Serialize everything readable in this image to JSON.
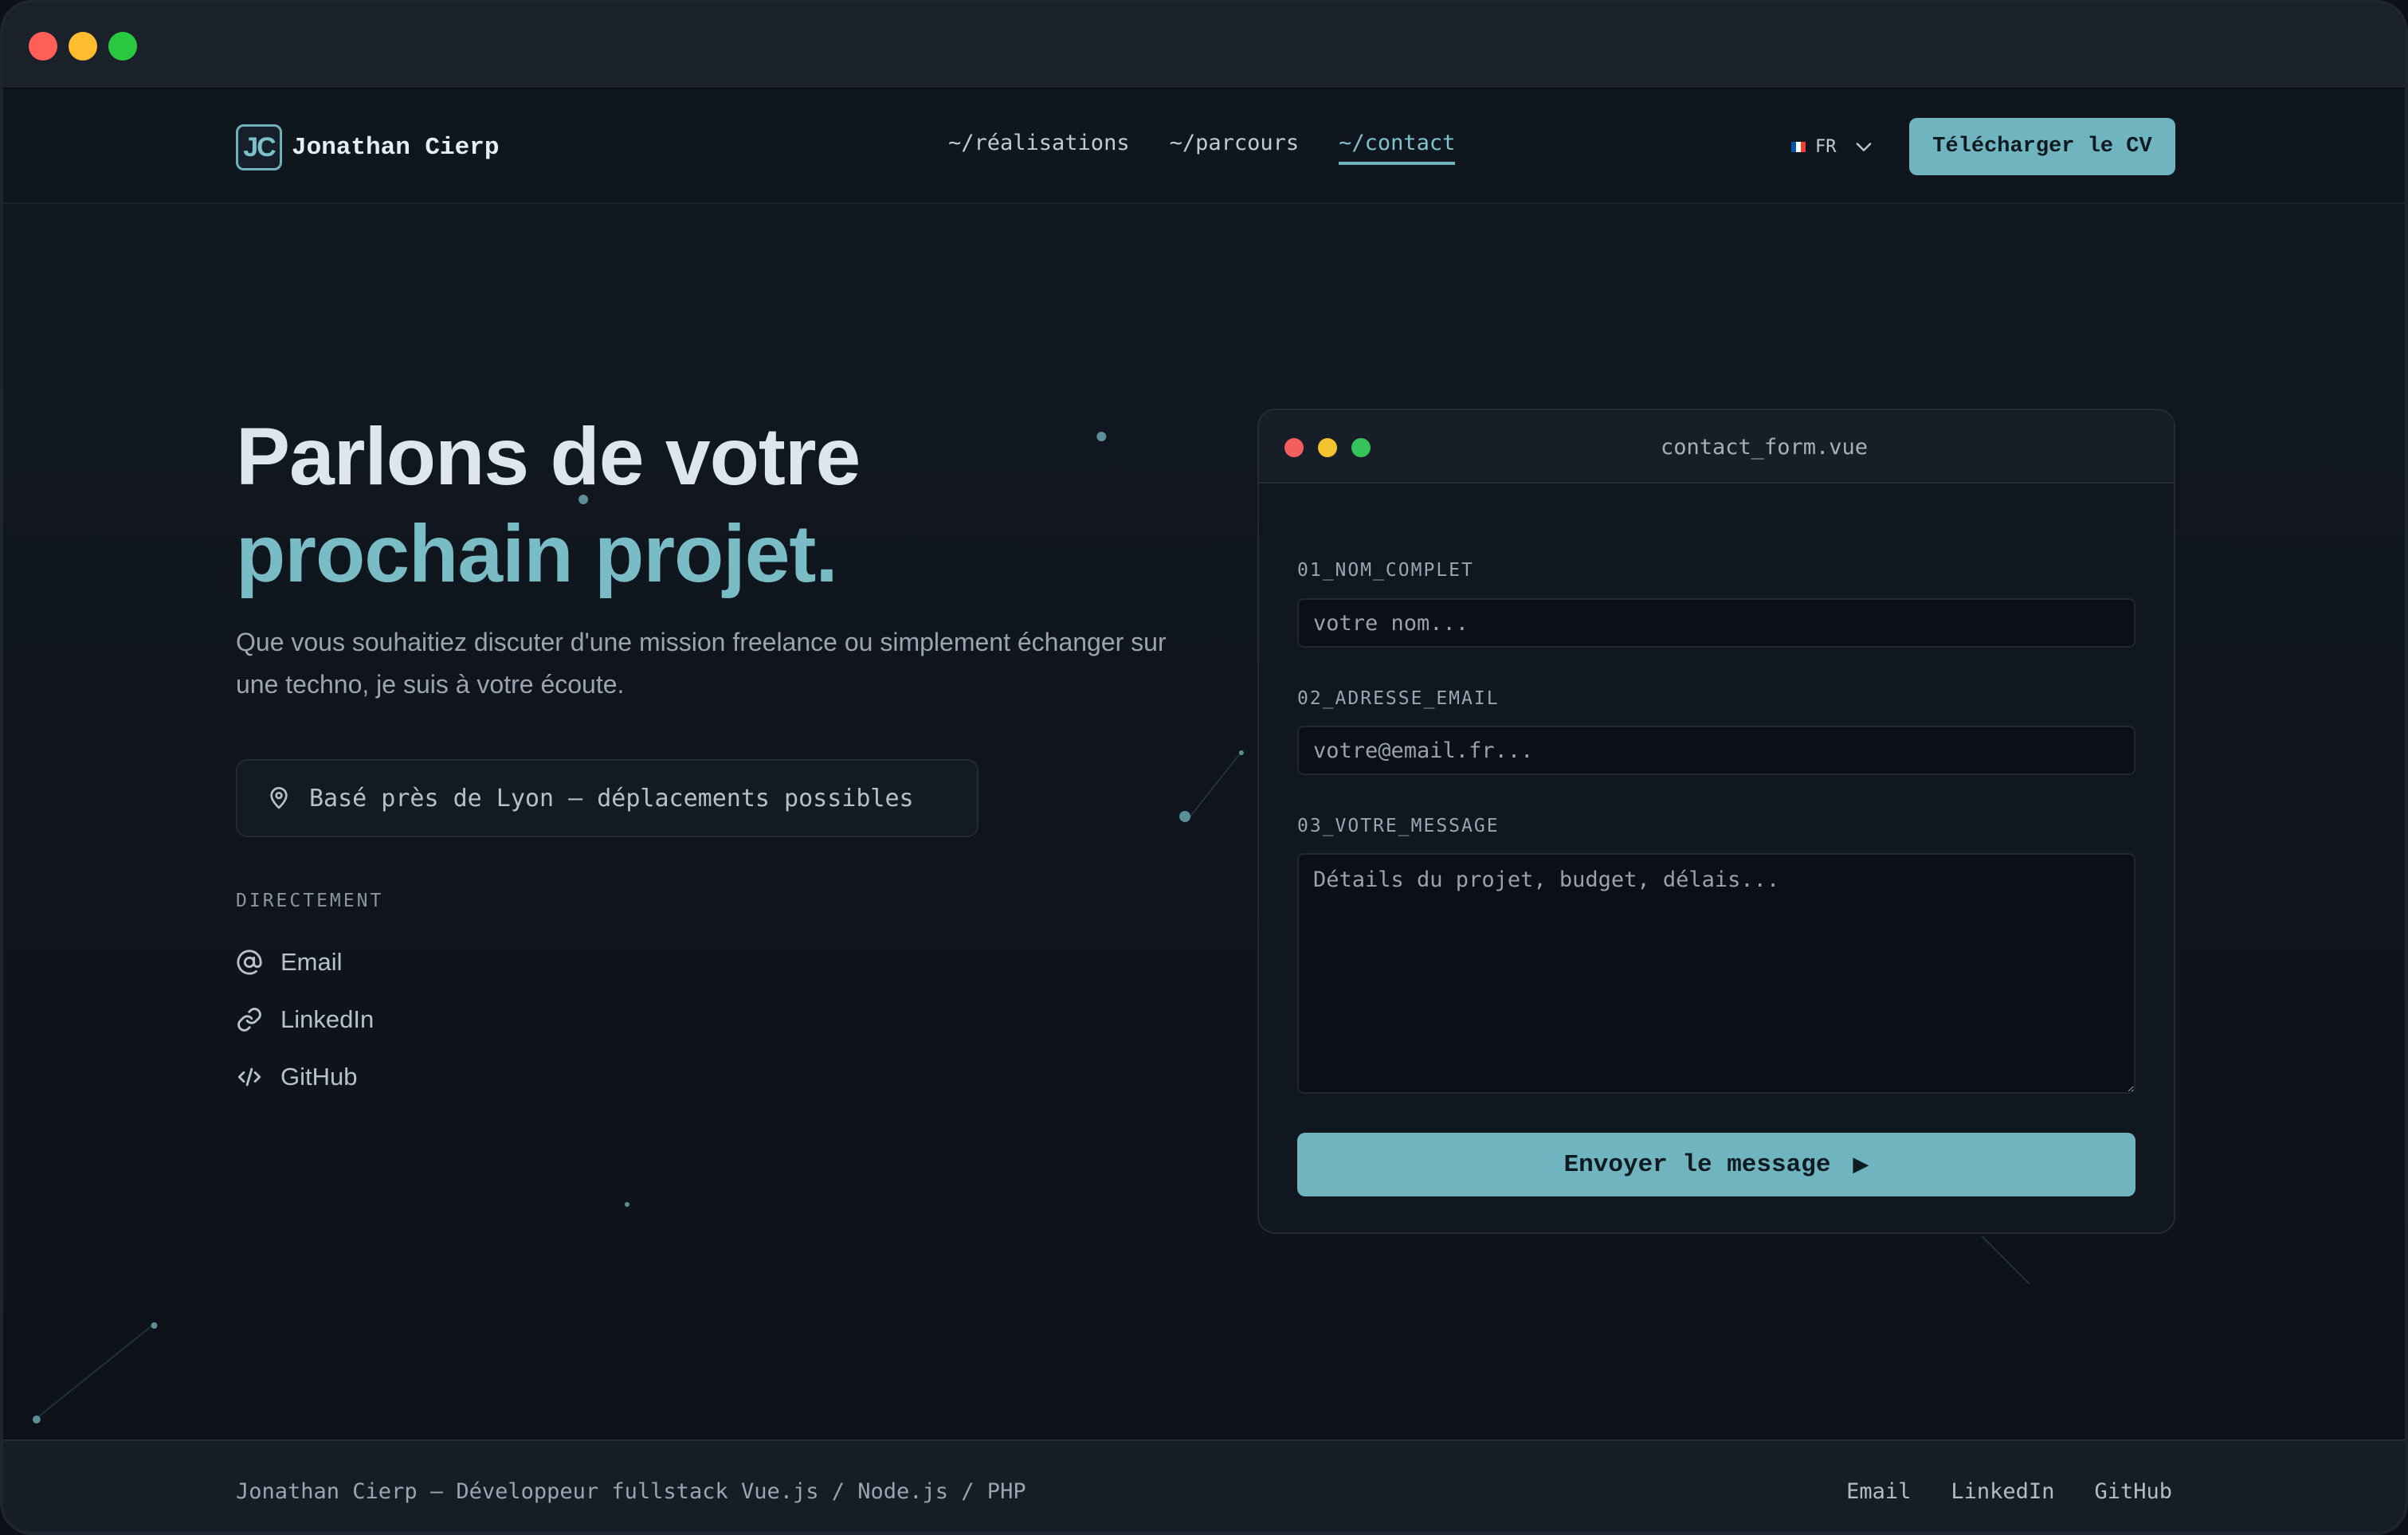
{
  "brand": {
    "logo": "JC",
    "name": "Jonathan Cierp"
  },
  "nav": {
    "links": [
      {
        "label": "~/réalisations",
        "active": false
      },
      {
        "label": "~/parcours",
        "active": false
      },
      {
        "label": "~/contact",
        "active": true
      }
    ]
  },
  "lang": {
    "code": "FR",
    "flag_colors": [
      "#0055a4",
      "#ffffff",
      "#ef4135"
    ]
  },
  "cv_button": {
    "label": "Télécharger le CV"
  },
  "hero": {
    "title_line1": "Parlons de votre",
    "title_line2": "prochain projet.",
    "subtitle": "Que vous souhaitiez discuter d'une mission freelance ou simplement échanger sur une techno, je suis à votre écoute."
  },
  "location": {
    "text": "Basé près de Lyon — déplacements possibles",
    "icon": "map-pin-icon"
  },
  "direct": {
    "title": "DIRECTEMENT",
    "items": [
      {
        "label": "Email",
        "icon": "at-icon"
      },
      {
        "label": "LinkedIn",
        "icon": "link-icon"
      },
      {
        "label": "GitHub",
        "icon": "code-icon"
      }
    ]
  },
  "form": {
    "filename": "contact_form.vue",
    "fields": [
      {
        "label": "01_NOM_COMPLET",
        "placeholder": "votre nom..."
      },
      {
        "label": "02_ADRESSE_EMAIL",
        "placeholder": "votre@email.fr..."
      },
      {
        "label": "03_VOTRE_MESSAGE",
        "placeholder": "Détails du projet, budget, délais..."
      }
    ],
    "submit_label": "Envoyer le message",
    "submit_icon": "▶"
  },
  "footer": {
    "tagline": "Jonathan Cierp — Développeur fullstack Vue.js / Node.js / PHP",
    "links": [
      "Email",
      "LinkedIn",
      "GitHub"
    ]
  },
  "colors": {
    "accent": "#6fb4bf",
    "background": "#0d1117",
    "traffic_red": "#fe5f57",
    "traffic_yellow": "#febc2e",
    "traffic_green": "#28c840"
  }
}
